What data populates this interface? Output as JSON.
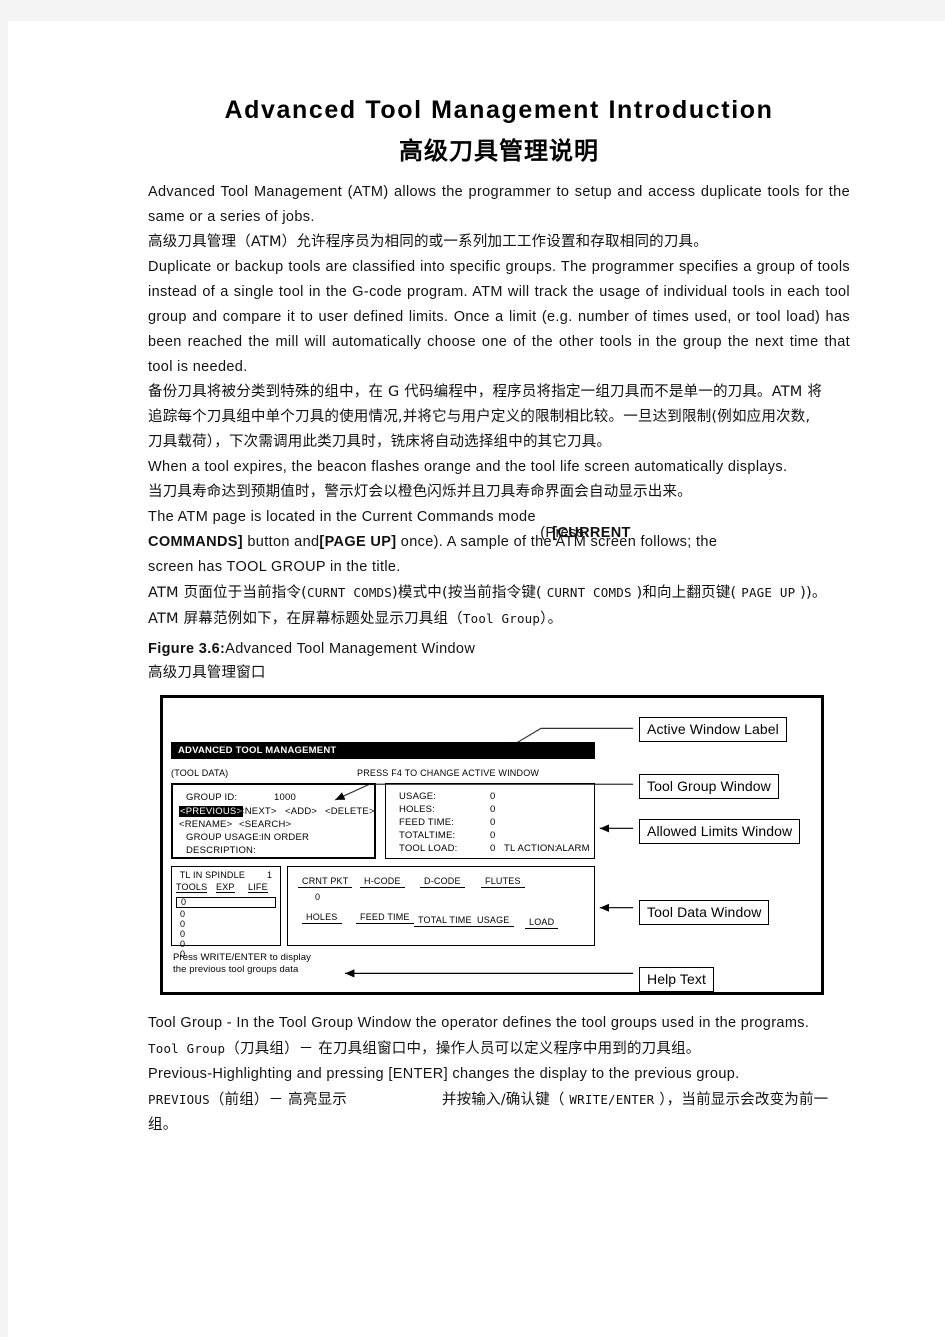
{
  "title": "Advanced Tool Management Introduction",
  "subtitle": "高级刀具管理说明",
  "paragraphs": {
    "p1_en": "Advanced Tool Management (ATM) allows the programmer to setup and access duplicate tools for the same or a series of jobs.",
    "p1_cn": "高级刀具管理（ATM）允许程序员为相同的或一系列加工工作设置和存取相同的刀具。",
    "p2_en": "Duplicate or backup tools are classified into specific groups. The programmer specifies a group of tools instead of a single tool in the G-code program. ATM will track the usage of individual tools in each tool group and compare it to user defined limits. Once a limit (e.g. number of times used, or tool load) has been reached the mill will automatically choose one of the other tools in the group the next time that tool is needed.",
    "p2_cn_l1": "备份刀具将被分类到特殊的组中，在 G 代码编程中，程序员将指定一组刀具而不是单一的刀具。ATM 将",
    "p2_cn_l2": "追踪每个刀具组中单个刀具的使用情况,并将它与用户定义的限制相比较。一旦达到限制(例如应用次数,",
    "p2_cn_l3": "刀具载荷），下次需调用此类刀具时，铣床将自动选择组中的其它刀具。",
    "p3_en": "When a tool expires, the beacon flashes orange and the tool life screen automatically displays.",
    "p3_cn": "当刀具寿命达到预期值时，警示灯会以橙色闪烁并且刀具寿命界面会自动显示出来。",
    "p4_en_pre": "The ATM page is located in the Current Commands mode ",
    "p4_en_overlap_a": "(Press",
    "p4_en_overlap_b": "[CURRENT",
    "p4_en_l2_a": "COMMANDS]",
    "p4_en_l2_b": " button and",
    "p4_en_l2_c": "[PAGE UP]",
    "p4_en_l2_d": " once). A sample of the ATM screen follows; the",
    "p4_en_l3": "screen has TOOL GROUP in the title.",
    "p4_cn_l1_a": "ATM 页面位于当前指令(",
    "p4_cn_l1_m1": "CURNT COMDS",
    "p4_cn_l1_b": ")模式中(按当前指令键( ",
    "p4_cn_l1_m2": "CURNT COMDS",
    "p4_cn_l1_c": " )和向上翻页键( ",
    "p4_cn_l1_m3": "PAGE UP",
    "p4_cn_l1_d": " ))。",
    "p4_cn_l2_a": "ATM 屏幕范例如下，在屏幕标题处显示刀具组（",
    "p4_cn_l2_m": "Tool Group",
    "p4_cn_l2_b": "）。",
    "p5_en": "Tool Group - In the Tool Group Window the operator defines the tool groups used in the programs.",
    "p5_cn_a": "Tool Group",
    "p5_cn_b": "（刀具组）－ 在刀具组窗口中，操作人员可以定义程序中用到的刀具组。",
    "p6_en": "Previous-Highlighting   and pressing [ENTER] changes the display to the previous group.",
    "p6_cn_a": "PREVIOUS",
    "p6_cn_b": "（前组）－ 高亮显示",
    "p6_cn_c": "并按输入/确认键（ ",
    "p6_cn_m": "WRITE/ENTER",
    "p6_cn_d": " ），当前显示会改变为前一",
    "p6_cn_l2": "组。"
  },
  "figure": {
    "caption_label": "Figure 3.6:",
    "caption_text": "Advanced Tool Management Window",
    "caption_cn": "高级刀具管理窗口",
    "titlebar": "ADVANCED TOOL MANAGEMENT",
    "tool_data_label": "(TOOL DATA)",
    "press_f4": "PRESS F4 TO CHANGE ACTIVE WINDOW",
    "group_window": {
      "group_id_label": "GROUP ID:",
      "group_id_value": "1000",
      "btn_previous": "<PREVIOUS>",
      "btn_next": "<NEXT>",
      "btn_add": "<ADD>",
      "btn_delete": "<DELETE>",
      "btn_rename": "<RENAME>",
      "btn_search": "<SEARCH>",
      "group_usage_label": "GROUP  USAGE:",
      "group_usage_value": "IN ORDER",
      "description_label": "DESCRIPTION:"
    },
    "limits_window": {
      "rows": [
        {
          "label": "USAGE:",
          "value": "0"
        },
        {
          "label": "HOLES:",
          "value": "0"
        },
        {
          "label": "FEED TIME:",
          "value": "0"
        },
        {
          "label": "TOTALTIME:",
          "value": "0"
        },
        {
          "label": "TOOL LOAD:",
          "value": "0"
        }
      ],
      "tl_action_label": "TL  ACTION:",
      "tl_action_value": "ALARM"
    },
    "spindle_window": {
      "title": "TL IN SPINDLE",
      "spindle_number": "1",
      "columns": [
        "TOOLS",
        "EXP",
        "LIFE"
      ],
      "rows": [
        "0",
        "0",
        "0",
        "0",
        "0",
        "0"
      ]
    },
    "tool_data_window": {
      "row1_headers": [
        "CRNT PKT",
        "H-CODE",
        "D-CODE",
        "FLUTES"
      ],
      "row1_values": [
        "0"
      ],
      "row2_headers": [
        "HOLES",
        "FEED TIME",
        "TOTAL TIME",
        "USAGE",
        "LOAD"
      ]
    },
    "help_text_line1": "Press WRITE/ENTER to display",
    "help_text_line2": "the previous tool groups data",
    "callouts": [
      "Active Window Label",
      "Tool Group Window",
      "Allowed Limits Window",
      "Tool Data Window",
      "Help Text"
    ]
  },
  "colors": {
    "page_bg": "#ffffff",
    "outer_bg": "#f4f4f4",
    "text": "#111111",
    "titlebar_bg": "#000000",
    "titlebar_fg": "#ffffff"
  }
}
